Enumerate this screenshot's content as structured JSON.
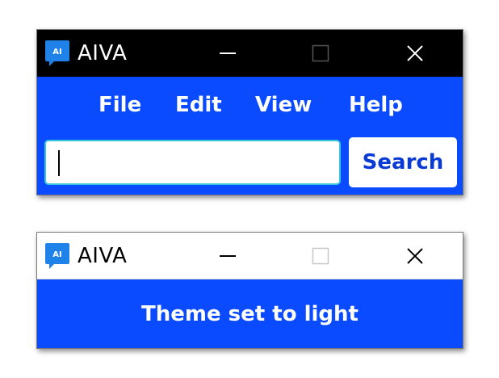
{
  "colors": {
    "accent": "#0a4bff",
    "dark_titlebar": "#000000",
    "light_titlebar": "#ffffff",
    "search_text": "#0a3ad6",
    "input_focus_border": "#38c7d8",
    "app_icon": "#1e82e8"
  },
  "search_window": {
    "title": "AIVA",
    "icon_text": "AI",
    "controls": [
      "minimize-icon",
      "maximize-icon",
      "close-icon"
    ],
    "menu": {
      "items": [
        {
          "label": "File"
        },
        {
          "label": "Edit"
        },
        {
          "label": "View"
        },
        {
          "label": "Help"
        }
      ]
    },
    "search": {
      "value": "",
      "placeholder": "",
      "button_label": "Search"
    }
  },
  "notification_window": {
    "title": "AIVA",
    "icon_text": "AI",
    "controls": [
      "minimize-icon",
      "maximize-icon",
      "close-icon"
    ],
    "message": "Theme set to light"
  }
}
